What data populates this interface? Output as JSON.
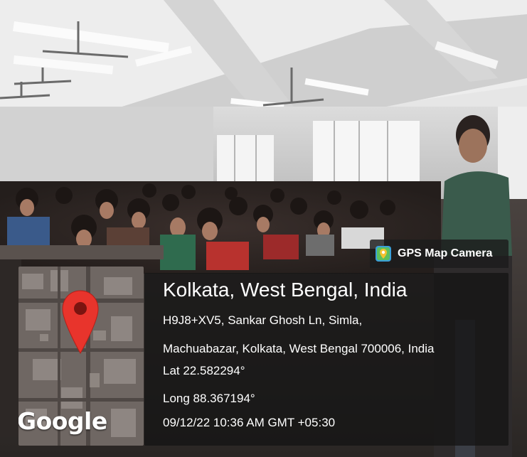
{
  "brand": {
    "name": "GPS Map Camera",
    "icon": "gps-map-camera-icon"
  },
  "location": {
    "title": "Kolkata, West Bengal, India",
    "address_line1": "H9J8+XV5, Sankar Ghosh Ln, Simla,",
    "address_line2": "Machuabazar, Kolkata, West Bengal 700006, India",
    "lat": "Lat 22.582294°",
    "long": "Long 88.367194°",
    "datetime": "09/12/22 10:36 AM GMT +05:30"
  },
  "map": {
    "logo_text": "Google",
    "pin_icon": "map-pin-icon",
    "pin_color": "#e8342c"
  },
  "colors": {
    "panel_bg": "#141414",
    "text": "#ffffff"
  }
}
